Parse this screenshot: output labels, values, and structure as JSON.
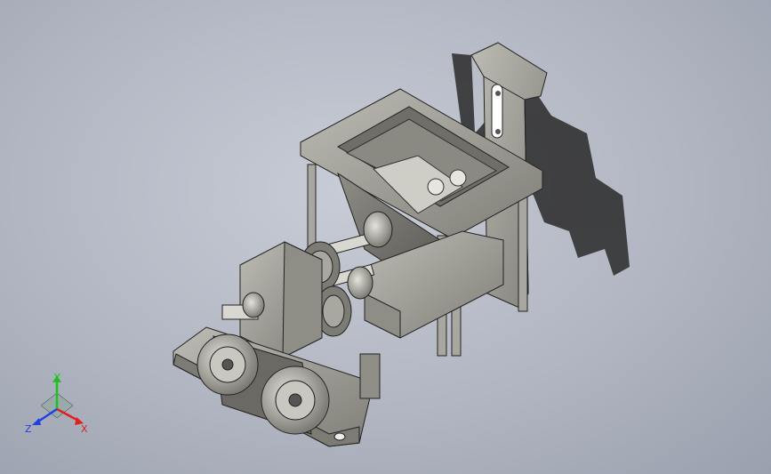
{
  "triad": {
    "x_label": "X",
    "y_label": "Y",
    "z_label": "Z",
    "x_color": "#e02020",
    "y_color": "#20c020",
    "z_color": "#2040e0"
  },
  "viewport": {
    "background_color": "#b4b9c4",
    "model_color": "#a3a29a",
    "shadow_color": "#2a2a2a"
  }
}
